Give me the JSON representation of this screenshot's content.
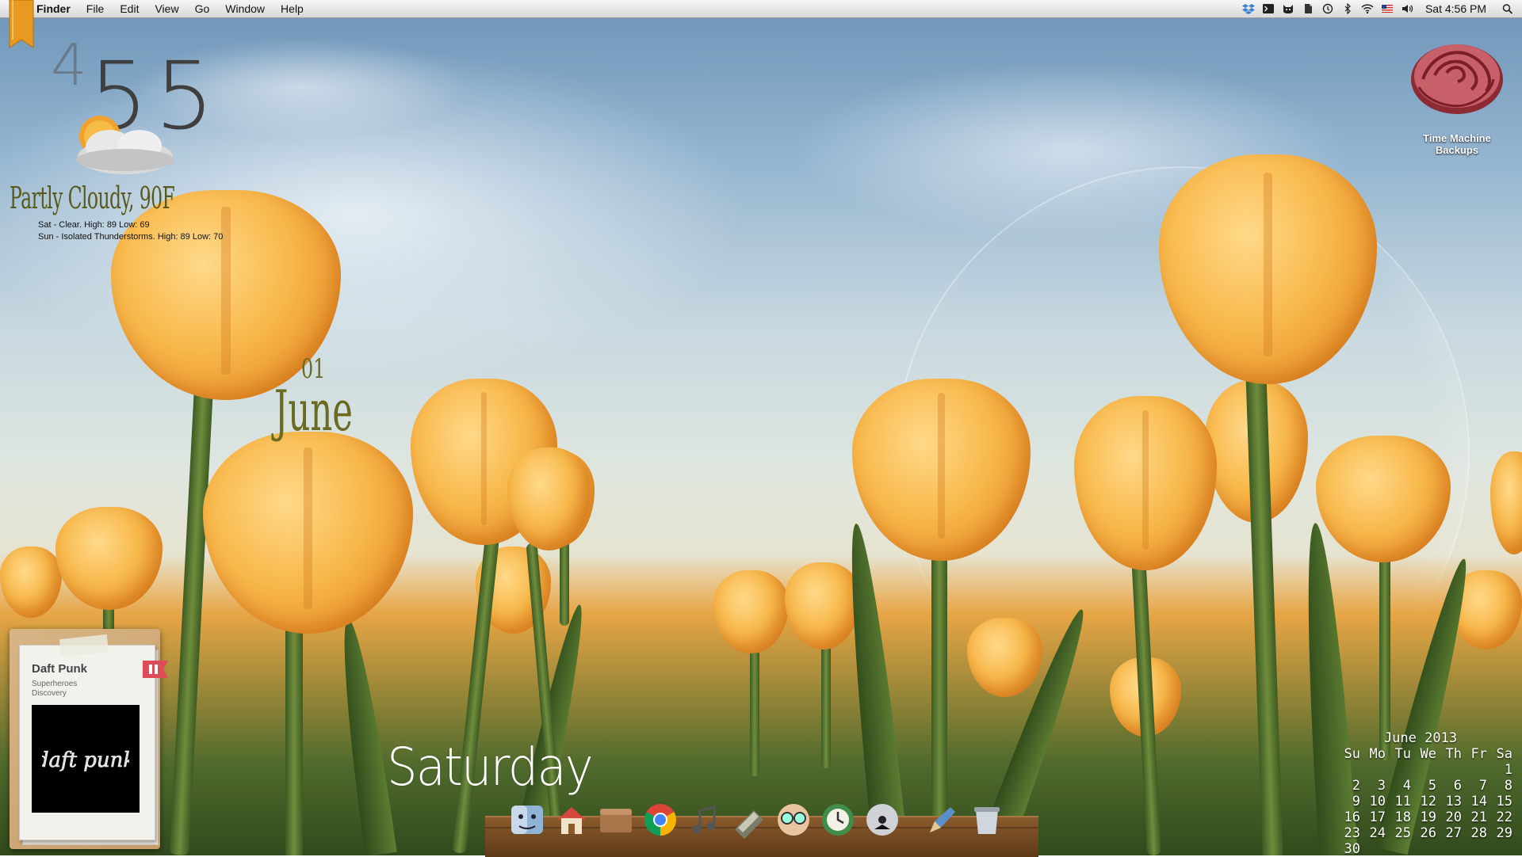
{
  "menubar": {
    "app_name": "Finder",
    "menus": [
      "File",
      "Edit",
      "View",
      "Go",
      "Window",
      "Help"
    ],
    "status_icons": [
      "dropbox-icon",
      "terminal-icon",
      "cat-icon",
      "evernote-icon",
      "time-machine-icon",
      "bluetooth-icon",
      "wifi-icon",
      "us-flag-icon",
      "volume-icon"
    ],
    "clock": "Sat 4:56 PM"
  },
  "clock_widget": {
    "hour": "4",
    "minutes": "55"
  },
  "weather": {
    "condition": "Partly Cloudy, 90F",
    "forecast": [
      "Sat - Clear. High: 89 Low: 69",
      "Sun - Isolated Thunderstorms. High: 89 Low: 70"
    ]
  },
  "date_widget": {
    "day": "01",
    "month": "June",
    "weekday": "Saturday"
  },
  "desktop_icons": [
    {
      "label_line1": "Time Machine",
      "label_line2": "Backups",
      "icon": "rose-icon"
    }
  ],
  "calendar": {
    "title": "June 2013",
    "weekdays": [
      "Su",
      "Mo",
      "Tu",
      "We",
      "Th",
      "Fr",
      "Sa"
    ],
    "weeks": [
      [
        "",
        "",
        "",
        "",
        "",
        "",
        "1"
      ],
      [
        "2",
        "3",
        "4",
        "5",
        "6",
        "7",
        "8"
      ],
      [
        "9",
        "10",
        "11",
        "12",
        "13",
        "14",
        "15"
      ],
      [
        "16",
        "17",
        "18",
        "19",
        "20",
        "21",
        "22"
      ],
      [
        "23",
        "24",
        "25",
        "26",
        "27",
        "28",
        "29"
      ],
      [
        "30",
        "",
        "",
        "",
        "",
        "",
        ""
      ]
    ]
  },
  "now_playing": {
    "artist": "Daft Punk",
    "track": "Superheroes",
    "album": "Discovery",
    "album_art_text": "daft punk"
  },
  "dock": {
    "items": [
      "finder-icon",
      "home-icon",
      "box-icon",
      "chrome-icon",
      "music-icon",
      "notebook-icon",
      "glasses-icon",
      "clock-icon",
      "dvd-icon",
      "pen-icon",
      "trash-icon"
    ]
  },
  "colors": {
    "weather_text": "#5a5a1c",
    "date_text": "#6a6a20",
    "tulip": "#f8b84a"
  }
}
